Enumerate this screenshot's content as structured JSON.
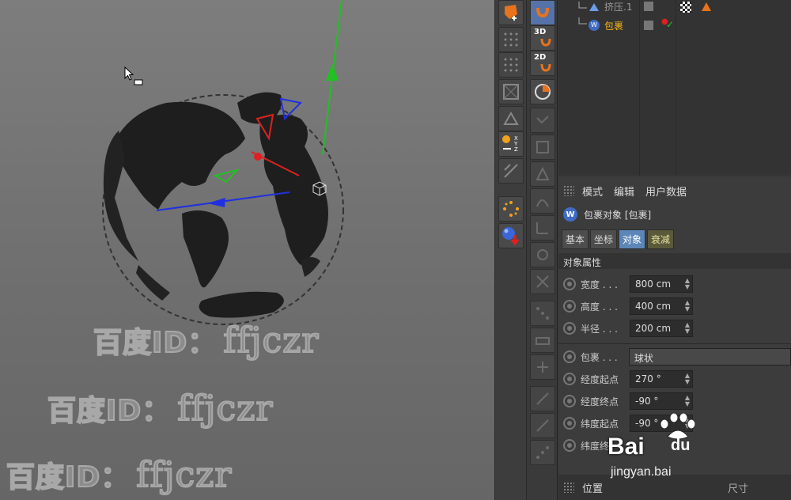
{
  "objects": {
    "rows": [
      {
        "label": "挤压.1"
      },
      {
        "label": "包裹"
      }
    ]
  },
  "toolbar": {
    "label_3d": "3D",
    "label_2d": "2D",
    "label_xyz": "X\nY\nZ"
  },
  "attributes": {
    "menu": [
      "模式",
      "编辑",
      "用户数据"
    ],
    "object_title": "包裹对象 [包裹]",
    "tabs": [
      "基本",
      "坐标",
      "对象",
      "衰减"
    ],
    "section": "对象属性",
    "props": [
      {
        "label": "宽度 . . .",
        "value": "800 cm"
      },
      {
        "label": "高度 . . .",
        "value": "400 cm"
      },
      {
        "label": "半径 . . .",
        "value": "200 cm"
      },
      {
        "label": "包裹 . . .",
        "value": "球状"
      },
      {
        "label": "经度起点",
        "value": "270 °"
      },
      {
        "label": "经度终点",
        "value": "-90 °"
      },
      {
        "label": "纬度起点",
        "value": "-90 °"
      },
      {
        "label": "纬度终",
        "value": ""
      }
    ],
    "bottom_label": "位置",
    "bottom_right": "尺寸"
  },
  "watermarks": [
    {
      "cn": "百度ID：",
      "en": "ffjczr"
    },
    {
      "cn": "百度ID：",
      "en": "ffjczr"
    },
    {
      "cn": "百度ID：",
      "en": "ffjczr"
    }
  ],
  "logo": {
    "bai": "Bai",
    "du": "du",
    "site": "jingyan.bai"
  },
  "colors": {
    "accent_orange": "#e8731c",
    "tab_active": "#5c86b8",
    "axis_x": "#e02020",
    "axis_y": "#20c020",
    "axis_z": "#2030e0"
  }
}
